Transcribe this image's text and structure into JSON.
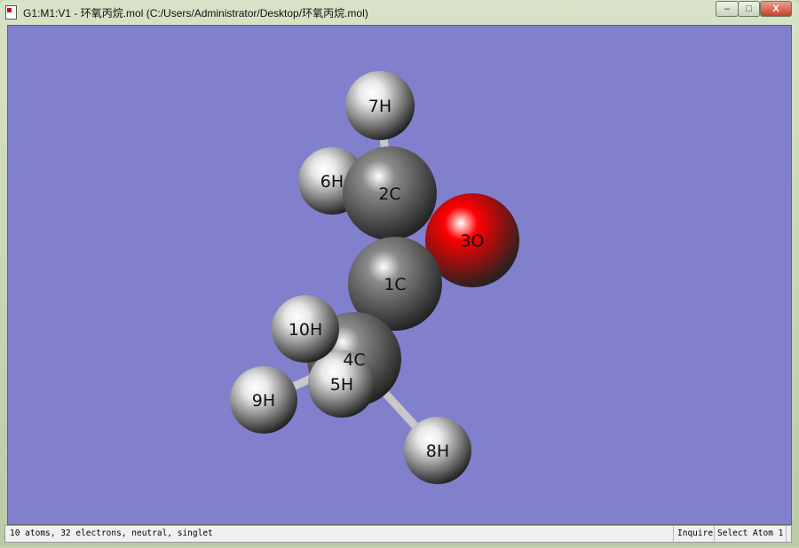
{
  "window": {
    "title": "G1:M1:V1 - 环氧丙烷.mol (C:/Users/Administrator/Desktop/环氧丙烷.mol)",
    "minimize_label": "–",
    "maximize_label": "□",
    "close_label": "X"
  },
  "viewer": {
    "background_color": "#8080cc",
    "atoms": [
      {
        "label": "1C",
        "element": "C",
        "color": "#8a8a8a"
      },
      {
        "label": "2C",
        "element": "C",
        "color": "#8a8a8a"
      },
      {
        "label": "3O",
        "element": "O",
        "color": "#ff0000"
      },
      {
        "label": "4C",
        "element": "C",
        "color": "#8a8a8a"
      },
      {
        "label": "5H",
        "element": "H",
        "color": "#e8e8e8"
      },
      {
        "label": "6H",
        "element": "H",
        "color": "#e8e8e8"
      },
      {
        "label": "7H",
        "element": "H",
        "color": "#e8e8e8"
      },
      {
        "label": "8H",
        "element": "H",
        "color": "#e8e8e8"
      },
      {
        "label": "9H",
        "element": "H",
        "color": "#e8e8e8"
      },
      {
        "label": "10H",
        "element": "H",
        "color": "#e8e8e8"
      }
    ]
  },
  "status": {
    "summary": "10 atoms, 32 electrons, neutral, singlet",
    "mode": "Inquire",
    "action": "Select Atom 1"
  }
}
